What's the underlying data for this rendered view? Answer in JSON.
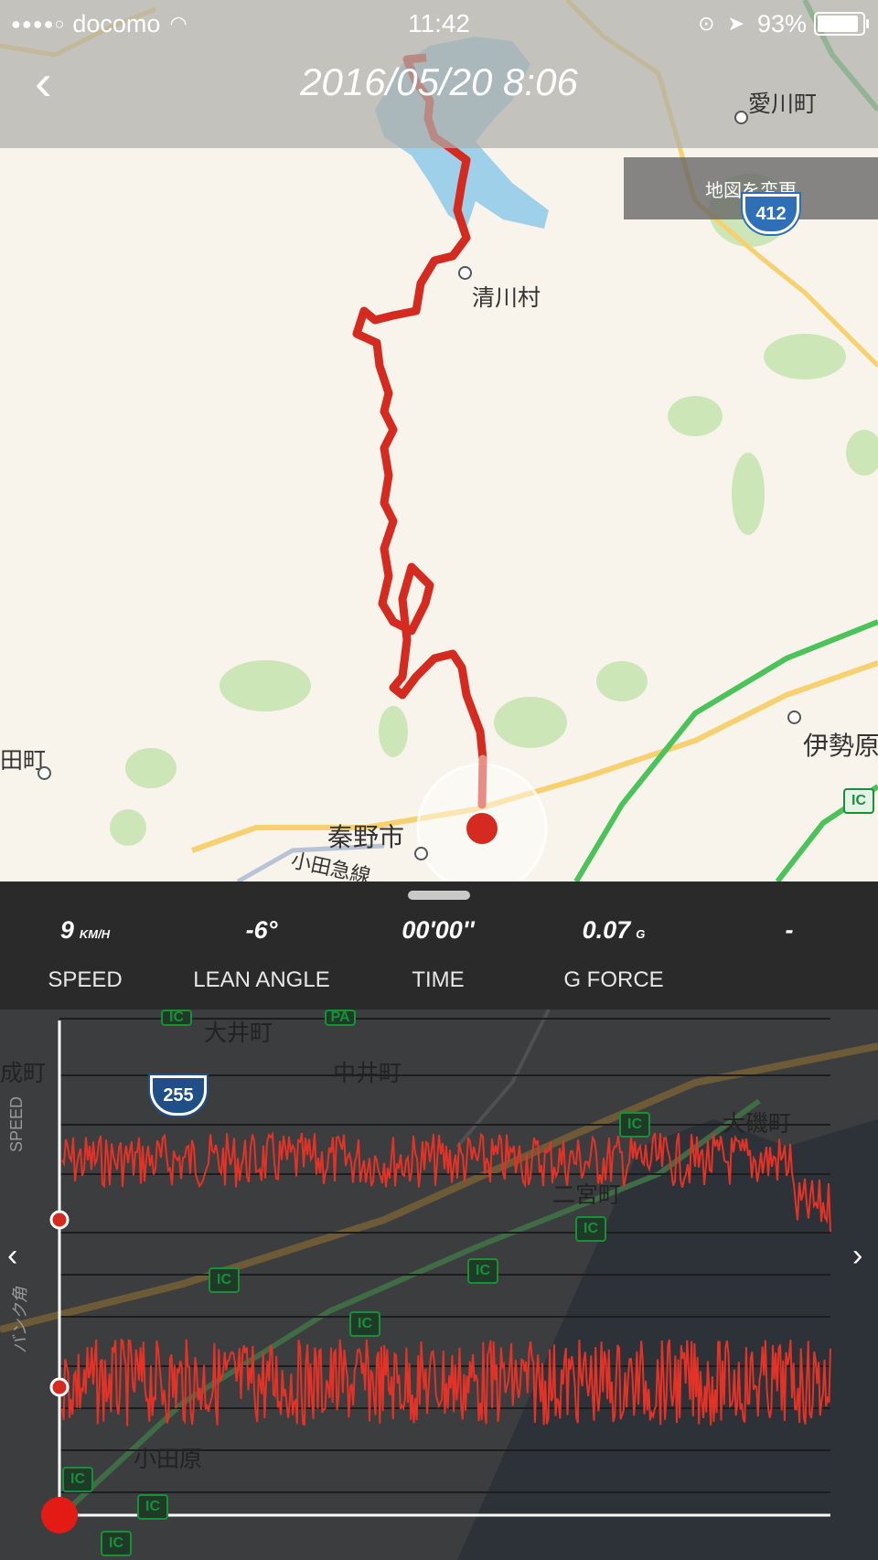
{
  "status_bar": {
    "signal": "●●●●○",
    "carrier": "docomo",
    "time": "11:42",
    "battery": "93%"
  },
  "header": {
    "back_label": "‹",
    "title": "2016/05/20 8:06"
  },
  "map": {
    "change_map_button": "地図を変更",
    "labels": {
      "aikawa": "愛川町",
      "kiyokawa": "清川村",
      "isehara": "伊勢原",
      "hadano": "秦野市",
      "odakyu": "小田急線",
      "left_town": "田町"
    },
    "route_shields": {
      "r412": "412"
    },
    "ic_badge": "IC",
    "colors": {
      "route": "#d42a20",
      "water": "#9fd0ea",
      "park": "#cce6b8",
      "highway": "#4cc35a",
      "road": "#f7d070"
    }
  },
  "stats": {
    "speed": {
      "value": "9",
      "unit": "KM/H",
      "label": "SPEED"
    },
    "lean": {
      "value": "-6°",
      "label": "LEAN ANGLE"
    },
    "time": {
      "value": "00'00''",
      "label": "TIME"
    },
    "gforce": {
      "value": "0.07",
      "unit": "G",
      "label": "G FORCE"
    },
    "extra": {
      "value": "-"
    }
  },
  "graph": {
    "speed_axis_label": "SPEED",
    "bank_axis_label": "バンク角",
    "bg_labels": {
      "oi": "大井町",
      "nakai": "中井町",
      "left": "成町",
      "oiso": "大磯町",
      "ninomiya": "二宮町",
      "odawara": "小田原",
      "route255": "255",
      "ic": "IC",
      "pa": "PA"
    },
    "nav_prev": "‹",
    "nav_next": "›",
    "line_color": "#e53227"
  }
}
